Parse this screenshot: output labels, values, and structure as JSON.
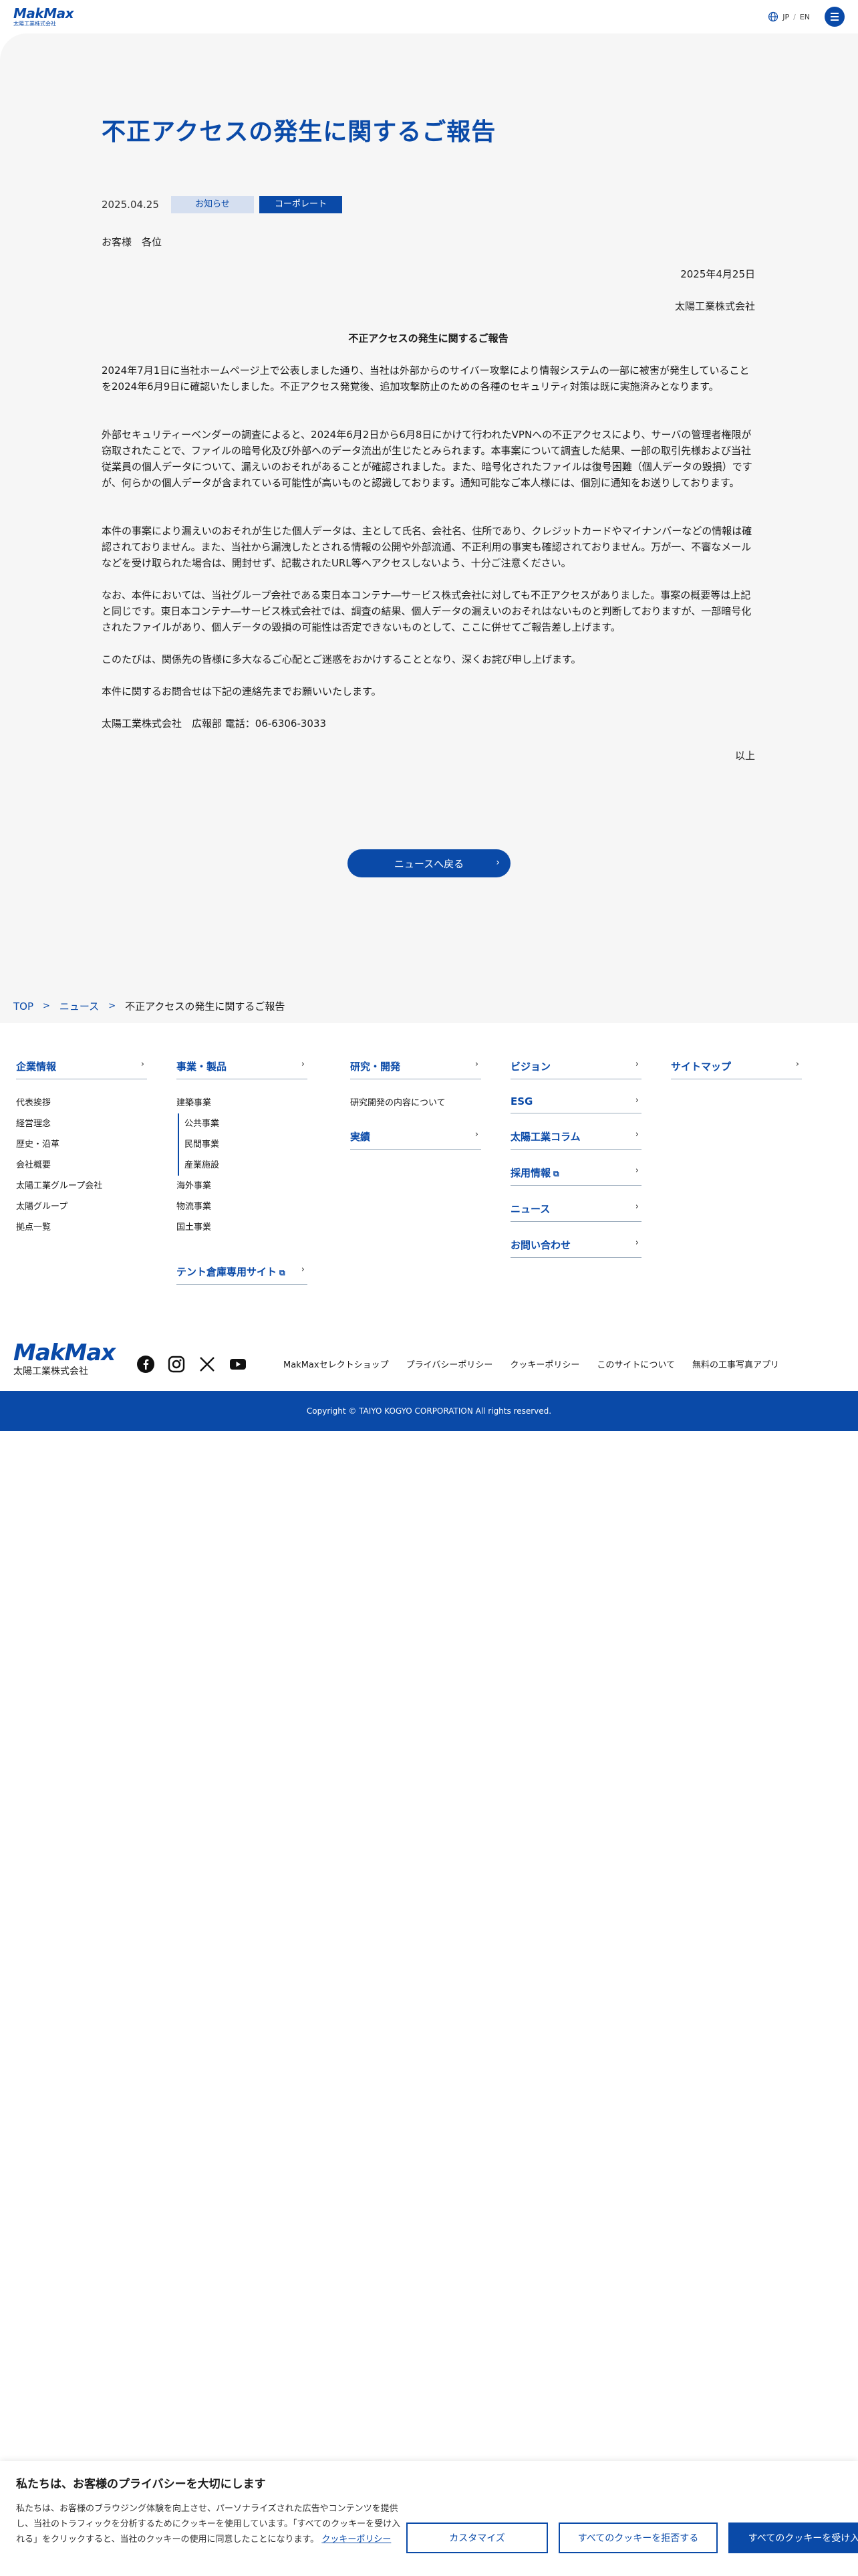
{
  "header": {
    "logo_text": "MakMax",
    "logo_sub": "太陽工業株式会社",
    "lang_jp": "JP",
    "lang_sep": "/",
    "lang_en": "EN"
  },
  "article": {
    "title": "不正アクセスの発生に関するご報告",
    "date": "2025.04.25",
    "tags": [
      "お知らせ",
      "コーポレート"
    ],
    "salutation": "お客様　各位",
    "issue_date": "2025年4月25日",
    "company": "太陽工業株式会社",
    "heading": "不正アクセスの発生に関するご報告",
    "paragraphs": [
      "2024年7月1日に当社ホームページ上で公表しました通り、当社は外部からのサイバー攻撃により情報システムの一部に被害が発生していることを2024年6月9日に確認いたしました。不正アクセス発覚後、追加攻撃防止のための各種のセキュリティ対策は既に実施済みとなります。",
      "外部セキュリティーベンダーの調査によると、2024年6月2日から6月8日にかけて行われたVPNへの不正アクセスにより、サーバの管理者権限が窃取されたことで、ファイルの暗号化及び外部へのデータ流出が生じたとみられます。本事案について調査した結果、一部の取引先様および当社従業員の個人データについて、漏えいのおそれがあることが確認されました。また、暗号化されたファイルは復号困難（個人データの毀損）ですが、何らかの個人データが含まれている可能性が高いものと認識しております。通知可能なご本人様には、個別に通知をお送りしております。",
      "本件の事案により漏えいのおそれが生じた個人データは、主として氏名、会社名、住所であり、クレジットカードやマイナンバーなどの情報は確認されておりません。また、当社から漏洩したとされる情報の公開や外部流通、不正利用の事実も確認されておりません。万が一、不審なメールなどを受け取られた場合は、開封せず、記載されたURL等へアクセスしないよう、十分ご注意ください。",
      "なお、本件においては、当社グループ会社である東日本コンテナ―サービス株式会社に対しても不正アクセスがありました。事案の概要等は上記と同じです。東日本コンテナ―サービス株式会社では、調査の結果、個人データの漏えいのおそれはないものと判断しておりますが、一部暗号化されたファイルがあり、個人データの毀損の可能性は否定できないものとして、ここに併せてご報告差し上げます。",
      "このたびは、関係先の皆様に多大なるご心配とご迷惑をおかけすることとなり、深くお詫び申し上げます。",
      "本件に関するお問合せは下記の連絡先までお願いいたします。",
      "太陽工業株式会社　広報部 電話：06-6306-3033"
    ],
    "closing": "以上",
    "back_button": "ニュースへ戻る"
  },
  "breadcrumb": {
    "top": "TOP",
    "news": "ニュース",
    "current": "不正アクセスの発生に関するご報告",
    "sep": ">"
  },
  "footer_nav": {
    "corporate": {
      "head": "企業情報",
      "items": [
        "代表挨拶",
        "経営理念",
        "歴史・沿革",
        "会社概要",
        "太陽工業グループ会社",
        "太陽グループ",
        "拠点一覧"
      ]
    },
    "business": {
      "head": "事業・製品",
      "items": [
        "建築事業",
        "公共事業",
        "民間事業",
        "産業施設",
        "海外事業",
        "物流事業",
        "国土事業"
      ],
      "tent_site": "テント倉庫専用サイト"
    },
    "research": {
      "head": "研究・開発",
      "items": [
        "研究開発の内容について"
      ],
      "results": "実績"
    },
    "vision_col": [
      "ビジョン",
      "ESG",
      "太陽工業コラム",
      "採用情報",
      "ニュース",
      "お問い合わせ"
    ],
    "sitemap": "サイトマップ"
  },
  "footer": {
    "logo_text": "MakMax",
    "logo_sub": "太陽工業株式会社",
    "links": [
      "MakMaxセレクトショップ",
      "プライバシーポリシー",
      "クッキーポリシー",
      "このサイトについて",
      "無料の工事写真アプリ"
    ],
    "copyright": "Copyright © TAIYO KOGYO CORPORATION All rights reserved."
  },
  "cookie": {
    "title": "私たちは、お客様のプライバシーを大切にします",
    "text": "私たちは、お客様のブラウジング体験を向上させ、パーソナライズされた広告やコンテンツを提供し、当社のトラフィックを分析するためにクッキーを使用しています。「すべてのクッキーを受け入れる」をクリックすると、当社のクッキーの使用に同意したことになります。",
    "policy_link": "クッキーポリシー",
    "btn_customize": "カスタマイズ",
    "btn_reject": "すべてのクッキーを拒否する",
    "btn_accept": "すべてのクッキーを受け入れる"
  },
  "colors": {
    "brand": "#0a4aa8",
    "tag_light": "#d5dff0",
    "gray_bg": "#f6f6f6"
  }
}
